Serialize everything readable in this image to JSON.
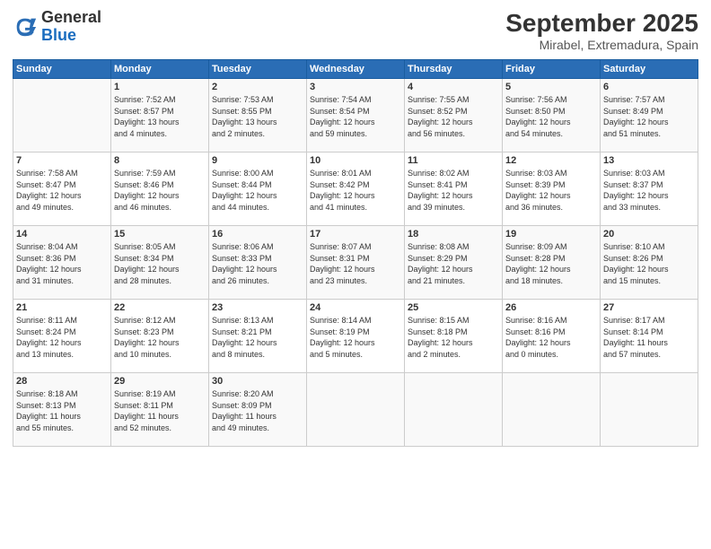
{
  "header": {
    "logo_general": "General",
    "logo_blue": "Blue",
    "month_title": "September 2025",
    "location": "Mirabel, Extremadura, Spain"
  },
  "weekdays": [
    "Sunday",
    "Monday",
    "Tuesday",
    "Wednesday",
    "Thursday",
    "Friday",
    "Saturday"
  ],
  "weeks": [
    [
      {
        "day": "",
        "info": ""
      },
      {
        "day": "1",
        "info": "Sunrise: 7:52 AM\nSunset: 8:57 PM\nDaylight: 13 hours\nand 4 minutes."
      },
      {
        "day": "2",
        "info": "Sunrise: 7:53 AM\nSunset: 8:55 PM\nDaylight: 13 hours\nand 2 minutes."
      },
      {
        "day": "3",
        "info": "Sunrise: 7:54 AM\nSunset: 8:54 PM\nDaylight: 12 hours\nand 59 minutes."
      },
      {
        "day": "4",
        "info": "Sunrise: 7:55 AM\nSunset: 8:52 PM\nDaylight: 12 hours\nand 56 minutes."
      },
      {
        "day": "5",
        "info": "Sunrise: 7:56 AM\nSunset: 8:50 PM\nDaylight: 12 hours\nand 54 minutes."
      },
      {
        "day": "6",
        "info": "Sunrise: 7:57 AM\nSunset: 8:49 PM\nDaylight: 12 hours\nand 51 minutes."
      }
    ],
    [
      {
        "day": "7",
        "info": "Sunrise: 7:58 AM\nSunset: 8:47 PM\nDaylight: 12 hours\nand 49 minutes."
      },
      {
        "day": "8",
        "info": "Sunrise: 7:59 AM\nSunset: 8:46 PM\nDaylight: 12 hours\nand 46 minutes."
      },
      {
        "day": "9",
        "info": "Sunrise: 8:00 AM\nSunset: 8:44 PM\nDaylight: 12 hours\nand 44 minutes."
      },
      {
        "day": "10",
        "info": "Sunrise: 8:01 AM\nSunset: 8:42 PM\nDaylight: 12 hours\nand 41 minutes."
      },
      {
        "day": "11",
        "info": "Sunrise: 8:02 AM\nSunset: 8:41 PM\nDaylight: 12 hours\nand 39 minutes."
      },
      {
        "day": "12",
        "info": "Sunrise: 8:03 AM\nSunset: 8:39 PM\nDaylight: 12 hours\nand 36 minutes."
      },
      {
        "day": "13",
        "info": "Sunrise: 8:03 AM\nSunset: 8:37 PM\nDaylight: 12 hours\nand 33 minutes."
      }
    ],
    [
      {
        "day": "14",
        "info": "Sunrise: 8:04 AM\nSunset: 8:36 PM\nDaylight: 12 hours\nand 31 minutes."
      },
      {
        "day": "15",
        "info": "Sunrise: 8:05 AM\nSunset: 8:34 PM\nDaylight: 12 hours\nand 28 minutes."
      },
      {
        "day": "16",
        "info": "Sunrise: 8:06 AM\nSunset: 8:33 PM\nDaylight: 12 hours\nand 26 minutes."
      },
      {
        "day": "17",
        "info": "Sunrise: 8:07 AM\nSunset: 8:31 PM\nDaylight: 12 hours\nand 23 minutes."
      },
      {
        "day": "18",
        "info": "Sunrise: 8:08 AM\nSunset: 8:29 PM\nDaylight: 12 hours\nand 21 minutes."
      },
      {
        "day": "19",
        "info": "Sunrise: 8:09 AM\nSunset: 8:28 PM\nDaylight: 12 hours\nand 18 minutes."
      },
      {
        "day": "20",
        "info": "Sunrise: 8:10 AM\nSunset: 8:26 PM\nDaylight: 12 hours\nand 15 minutes."
      }
    ],
    [
      {
        "day": "21",
        "info": "Sunrise: 8:11 AM\nSunset: 8:24 PM\nDaylight: 12 hours\nand 13 minutes."
      },
      {
        "day": "22",
        "info": "Sunrise: 8:12 AM\nSunset: 8:23 PM\nDaylight: 12 hours\nand 10 minutes."
      },
      {
        "day": "23",
        "info": "Sunrise: 8:13 AM\nSunset: 8:21 PM\nDaylight: 12 hours\nand 8 minutes."
      },
      {
        "day": "24",
        "info": "Sunrise: 8:14 AM\nSunset: 8:19 PM\nDaylight: 12 hours\nand 5 minutes."
      },
      {
        "day": "25",
        "info": "Sunrise: 8:15 AM\nSunset: 8:18 PM\nDaylight: 12 hours\nand 2 minutes."
      },
      {
        "day": "26",
        "info": "Sunrise: 8:16 AM\nSunset: 8:16 PM\nDaylight: 12 hours\nand 0 minutes."
      },
      {
        "day": "27",
        "info": "Sunrise: 8:17 AM\nSunset: 8:14 PM\nDaylight: 11 hours\nand 57 minutes."
      }
    ],
    [
      {
        "day": "28",
        "info": "Sunrise: 8:18 AM\nSunset: 8:13 PM\nDaylight: 11 hours\nand 55 minutes."
      },
      {
        "day": "29",
        "info": "Sunrise: 8:19 AM\nSunset: 8:11 PM\nDaylight: 11 hours\nand 52 minutes."
      },
      {
        "day": "30",
        "info": "Sunrise: 8:20 AM\nSunset: 8:09 PM\nDaylight: 11 hours\nand 49 minutes."
      },
      {
        "day": "",
        "info": ""
      },
      {
        "day": "",
        "info": ""
      },
      {
        "day": "",
        "info": ""
      },
      {
        "day": "",
        "info": ""
      }
    ]
  ]
}
